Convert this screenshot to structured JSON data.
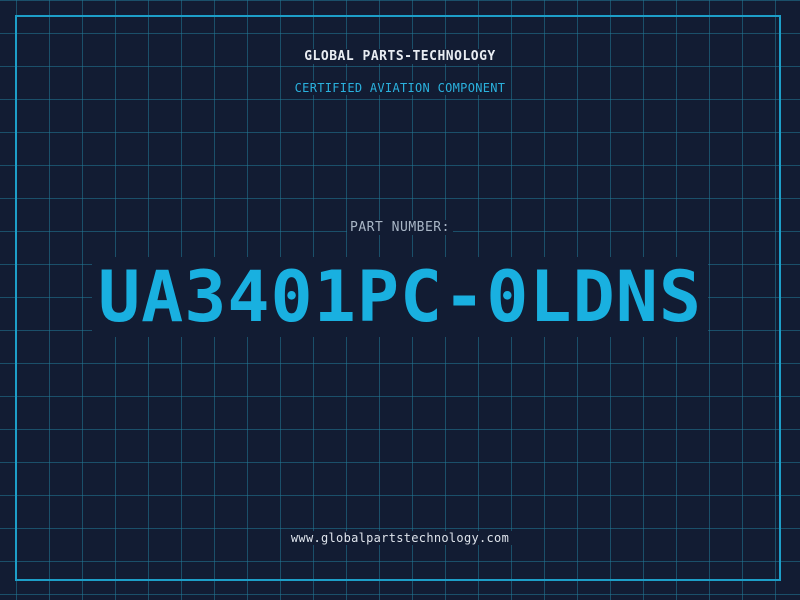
{
  "header": {
    "company": "GLOBAL PARTS-TECHNOLOGY",
    "tagline": "CERTIFIED AVIATION COMPONENT"
  },
  "part": {
    "label": "PART NUMBER:",
    "number": "UA3401PC-0LDNS"
  },
  "footer": {
    "url": "www.globalpartstechnology.com"
  },
  "colors": {
    "background": "#121c33",
    "grid_line": "#22788f",
    "frame": "#1d9ec8",
    "accent": "#19b0e0"
  }
}
